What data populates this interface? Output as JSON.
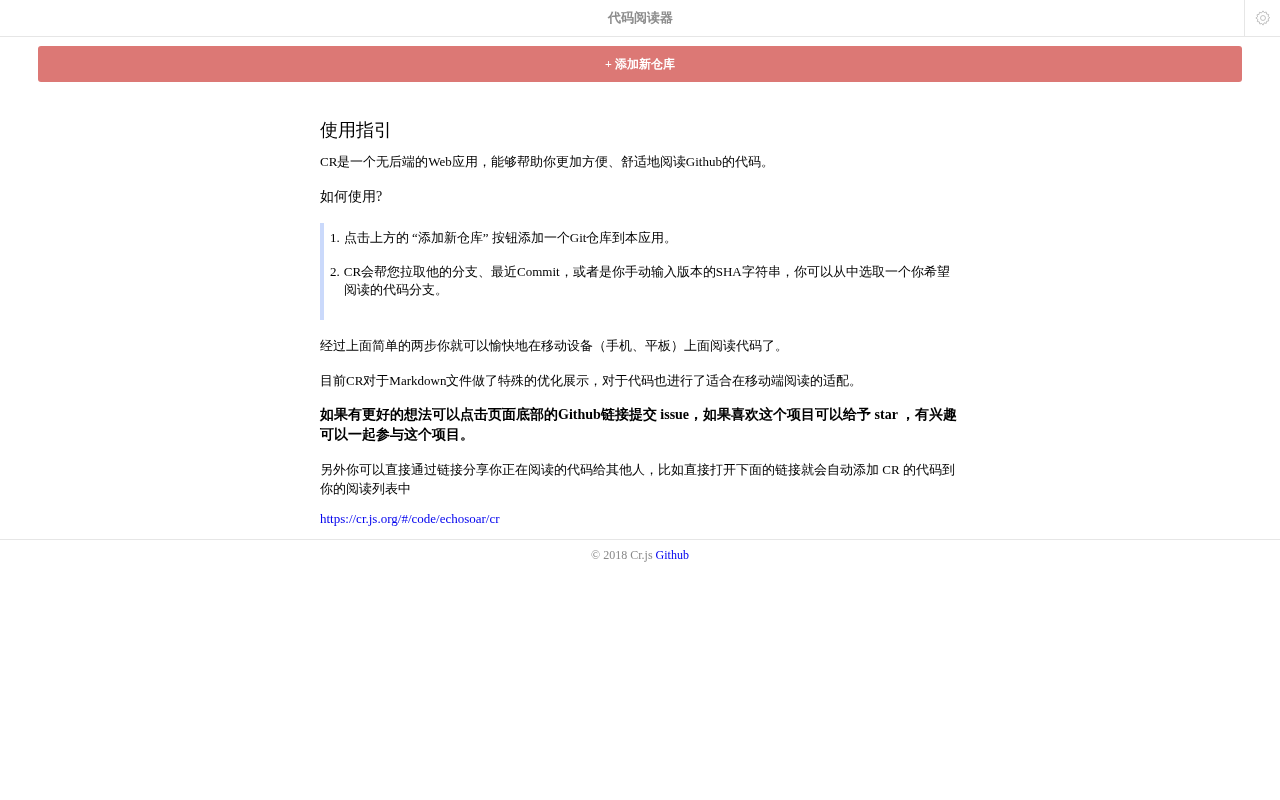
{
  "header": {
    "title": "代码阅读器"
  },
  "add_button": {
    "label": "+ 添加新仓库"
  },
  "guide": {
    "title": "使用指引",
    "intro": "CR是一个无后端的Web应用，能够帮助你更加方便、舒适地阅读Github的代码。",
    "subtitle": "如何使用?",
    "steps": [
      {
        "number": "1.",
        "text": "点击上方的 “添加新仓库” 按钮添加一个Git仓库到本应用。"
      },
      {
        "number": "2.",
        "text": "CR会帮您拉取他的分支、最近Commit，或者是你手动输入版本的SHA字符串，你可以从中选取一个你希望阅读的代码分支。"
      }
    ],
    "blocks": [
      {
        "kind": "text",
        "text": "经过上面简单的两步你就可以愉快地在移动设备（手机、平板）上面阅读代码了。"
      },
      {
        "kind": "text",
        "text": "目前CR对于Markdown文件做了特殊的优化展示，对于代码也进行了适合在移动端阅读的适配。"
      },
      {
        "kind": "strong",
        "text": "如果有更好的想法可以点击页面底部的Github链接提交 issue，如果喜欢这个项目可以给予 star ，有兴趣可以一起参与这个项目。"
      },
      {
        "kind": "text",
        "text": "另外你可以直接通过链接分享你正在阅读的代码给其他人，比如直接打开下面的链接就会自动添加 CR 的代码到你的阅读列表中"
      },
      {
        "kind": "link",
        "text": "https://cr.js.org/#/code/echosoar/cr"
      }
    ]
  },
  "footer": {
    "copyright": "© 2018 Cr.js",
    "link": "Github"
  }
}
